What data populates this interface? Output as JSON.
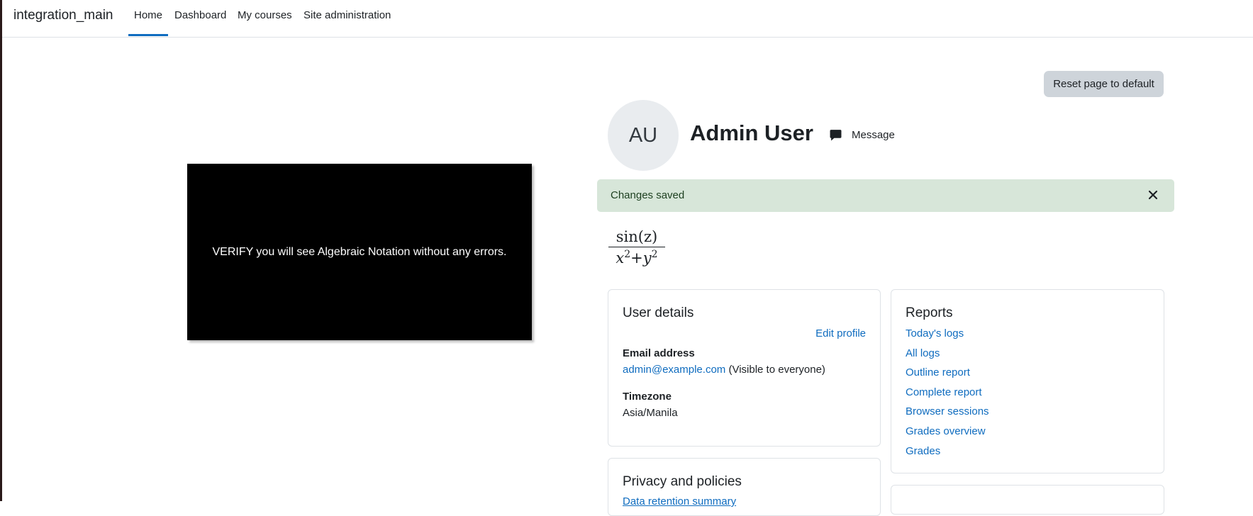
{
  "navbar": {
    "brand": "integration_main",
    "items": [
      {
        "label": "Home",
        "active": true
      },
      {
        "label": "Dashboard"
      },
      {
        "label": "My courses"
      },
      {
        "label": "Site administration"
      }
    ]
  },
  "video": {
    "caption": "VERIFY you will see Algebraic Notation without any errors."
  },
  "header": {
    "reset_label": "Reset page to default",
    "avatar_initials": "AU",
    "user_name": "Admin User",
    "message_label": "Message"
  },
  "alert": {
    "text": "Changes saved",
    "close_icon": "close-icon"
  },
  "formula": {
    "numerator": "sin(z)",
    "denominator_x": "x",
    "denominator_plus": "+",
    "denominator_y": "y",
    "exponent": "2"
  },
  "user_details": {
    "title": "User details",
    "edit_label": "Edit profile",
    "email_label": "Email address",
    "email_value": "admin@example.com",
    "email_visibility": "(Visible to everyone)",
    "timezone_label": "Timezone",
    "timezone_value": "Asia/Manila"
  },
  "reports": {
    "title": "Reports",
    "links": [
      "Today's logs",
      "All logs",
      "Outline report",
      "Complete report",
      "Browser sessions",
      "Grades overview",
      "Grades"
    ]
  },
  "privacy": {
    "title": "Privacy and policies",
    "link": "Data retention summary"
  },
  "colors": {
    "accent": "#0f6cbf",
    "alert_bg": "#d7e6d9",
    "button_bg": "#ced4da"
  }
}
